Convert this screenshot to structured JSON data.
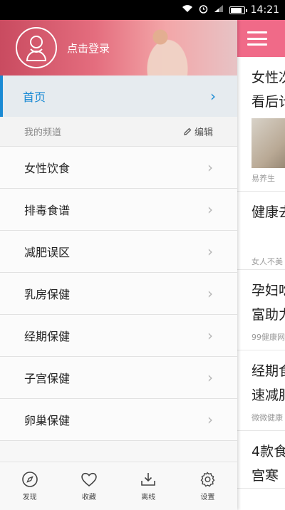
{
  "status_bar": {
    "time": "14:21"
  },
  "drawer": {
    "header": {
      "login_label": "点击登录"
    },
    "home": {
      "label": "首页"
    },
    "section": {
      "title": "我的频道",
      "edit_label": "编辑"
    },
    "items": [
      {
        "label": "女性饮食"
      },
      {
        "label": "排毒食谱"
      },
      {
        "label": "减肥误区"
      },
      {
        "label": "乳房保健"
      },
      {
        "label": "经期保健"
      },
      {
        "label": "子宫保健"
      },
      {
        "label": "卵巢保健"
      }
    ],
    "bottom_nav": [
      {
        "label": "发现",
        "icon": "compass-icon"
      },
      {
        "label": "收藏",
        "icon": "heart-icon"
      },
      {
        "label": "离线",
        "icon": "download-icon"
      },
      {
        "label": "设置",
        "icon": "gear-icon"
      }
    ]
  },
  "content": {
    "articles": [
      {
        "title_line1": "女性次",
        "title_line2": "看后计",
        "source": "易养生"
      },
      {
        "title_line1": "健康去",
        "title_line2": "",
        "source": "女人不美"
      },
      {
        "title_line1": "孕妇吃",
        "title_line2": "富助力",
        "source": "99健康网"
      },
      {
        "title_line1": "经期食",
        "title_line2": "速减肥",
        "source": "微微健康"
      },
      {
        "title_line1": "4款食",
        "title_line2": "宫寒",
        "source": ""
      }
    ]
  },
  "colors": {
    "accent": "#1a8ad4",
    "header_pink": "#f06a88"
  }
}
